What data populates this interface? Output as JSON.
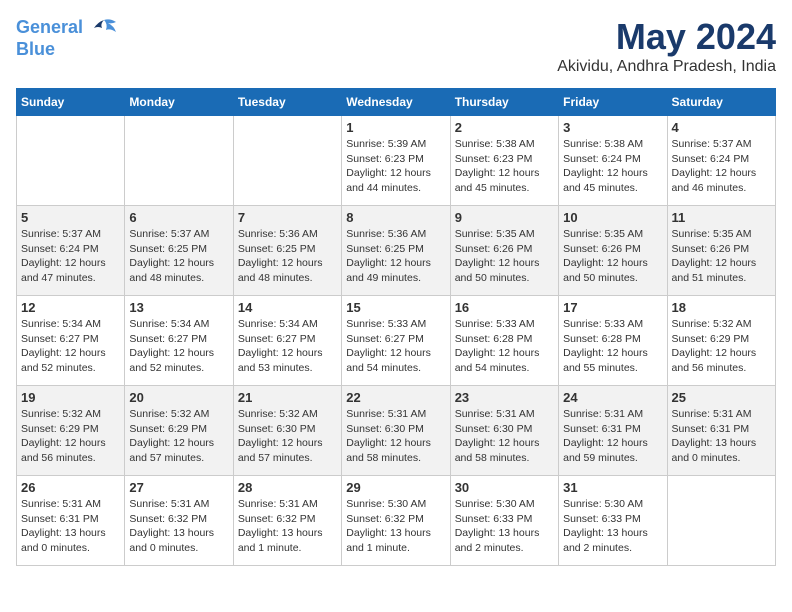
{
  "header": {
    "logo_line1": "General",
    "logo_line2": "Blue",
    "main_title": "May 2024",
    "subtitle": "Akividu, Andhra Pradesh, India"
  },
  "weekdays": [
    "Sunday",
    "Monday",
    "Tuesday",
    "Wednesday",
    "Thursday",
    "Friday",
    "Saturday"
  ],
  "weeks": [
    [
      {
        "day": "",
        "info": ""
      },
      {
        "day": "",
        "info": ""
      },
      {
        "day": "",
        "info": ""
      },
      {
        "day": "1",
        "info": "Sunrise: 5:39 AM\nSunset: 6:23 PM\nDaylight: 12 hours\nand 44 minutes."
      },
      {
        "day": "2",
        "info": "Sunrise: 5:38 AM\nSunset: 6:23 PM\nDaylight: 12 hours\nand 45 minutes."
      },
      {
        "day": "3",
        "info": "Sunrise: 5:38 AM\nSunset: 6:24 PM\nDaylight: 12 hours\nand 45 minutes."
      },
      {
        "day": "4",
        "info": "Sunrise: 5:37 AM\nSunset: 6:24 PM\nDaylight: 12 hours\nand 46 minutes."
      }
    ],
    [
      {
        "day": "5",
        "info": "Sunrise: 5:37 AM\nSunset: 6:24 PM\nDaylight: 12 hours\nand 47 minutes."
      },
      {
        "day": "6",
        "info": "Sunrise: 5:37 AM\nSunset: 6:25 PM\nDaylight: 12 hours\nand 48 minutes."
      },
      {
        "day": "7",
        "info": "Sunrise: 5:36 AM\nSunset: 6:25 PM\nDaylight: 12 hours\nand 48 minutes."
      },
      {
        "day": "8",
        "info": "Sunrise: 5:36 AM\nSunset: 6:25 PM\nDaylight: 12 hours\nand 49 minutes."
      },
      {
        "day": "9",
        "info": "Sunrise: 5:35 AM\nSunset: 6:26 PM\nDaylight: 12 hours\nand 50 minutes."
      },
      {
        "day": "10",
        "info": "Sunrise: 5:35 AM\nSunset: 6:26 PM\nDaylight: 12 hours\nand 50 minutes."
      },
      {
        "day": "11",
        "info": "Sunrise: 5:35 AM\nSunset: 6:26 PM\nDaylight: 12 hours\nand 51 minutes."
      }
    ],
    [
      {
        "day": "12",
        "info": "Sunrise: 5:34 AM\nSunset: 6:27 PM\nDaylight: 12 hours\nand 52 minutes."
      },
      {
        "day": "13",
        "info": "Sunrise: 5:34 AM\nSunset: 6:27 PM\nDaylight: 12 hours\nand 52 minutes."
      },
      {
        "day": "14",
        "info": "Sunrise: 5:34 AM\nSunset: 6:27 PM\nDaylight: 12 hours\nand 53 minutes."
      },
      {
        "day": "15",
        "info": "Sunrise: 5:33 AM\nSunset: 6:27 PM\nDaylight: 12 hours\nand 54 minutes."
      },
      {
        "day": "16",
        "info": "Sunrise: 5:33 AM\nSunset: 6:28 PM\nDaylight: 12 hours\nand 54 minutes."
      },
      {
        "day": "17",
        "info": "Sunrise: 5:33 AM\nSunset: 6:28 PM\nDaylight: 12 hours\nand 55 minutes."
      },
      {
        "day": "18",
        "info": "Sunrise: 5:32 AM\nSunset: 6:29 PM\nDaylight: 12 hours\nand 56 minutes."
      }
    ],
    [
      {
        "day": "19",
        "info": "Sunrise: 5:32 AM\nSunset: 6:29 PM\nDaylight: 12 hours\nand 56 minutes."
      },
      {
        "day": "20",
        "info": "Sunrise: 5:32 AM\nSunset: 6:29 PM\nDaylight: 12 hours\nand 57 minutes."
      },
      {
        "day": "21",
        "info": "Sunrise: 5:32 AM\nSunset: 6:30 PM\nDaylight: 12 hours\nand 57 minutes."
      },
      {
        "day": "22",
        "info": "Sunrise: 5:31 AM\nSunset: 6:30 PM\nDaylight: 12 hours\nand 58 minutes."
      },
      {
        "day": "23",
        "info": "Sunrise: 5:31 AM\nSunset: 6:30 PM\nDaylight: 12 hours\nand 58 minutes."
      },
      {
        "day": "24",
        "info": "Sunrise: 5:31 AM\nSunset: 6:31 PM\nDaylight: 12 hours\nand 59 minutes."
      },
      {
        "day": "25",
        "info": "Sunrise: 5:31 AM\nSunset: 6:31 PM\nDaylight: 13 hours\nand 0 minutes."
      }
    ],
    [
      {
        "day": "26",
        "info": "Sunrise: 5:31 AM\nSunset: 6:31 PM\nDaylight: 13 hours\nand 0 minutes."
      },
      {
        "day": "27",
        "info": "Sunrise: 5:31 AM\nSunset: 6:32 PM\nDaylight: 13 hours\nand 0 minutes."
      },
      {
        "day": "28",
        "info": "Sunrise: 5:31 AM\nSunset: 6:32 PM\nDaylight: 13 hours\nand 1 minute."
      },
      {
        "day": "29",
        "info": "Sunrise: 5:30 AM\nSunset: 6:32 PM\nDaylight: 13 hours\nand 1 minute."
      },
      {
        "day": "30",
        "info": "Sunrise: 5:30 AM\nSunset: 6:33 PM\nDaylight: 13 hours\nand 2 minutes."
      },
      {
        "day": "31",
        "info": "Sunrise: 5:30 AM\nSunset: 6:33 PM\nDaylight: 13 hours\nand 2 minutes."
      },
      {
        "day": "",
        "info": ""
      }
    ]
  ]
}
